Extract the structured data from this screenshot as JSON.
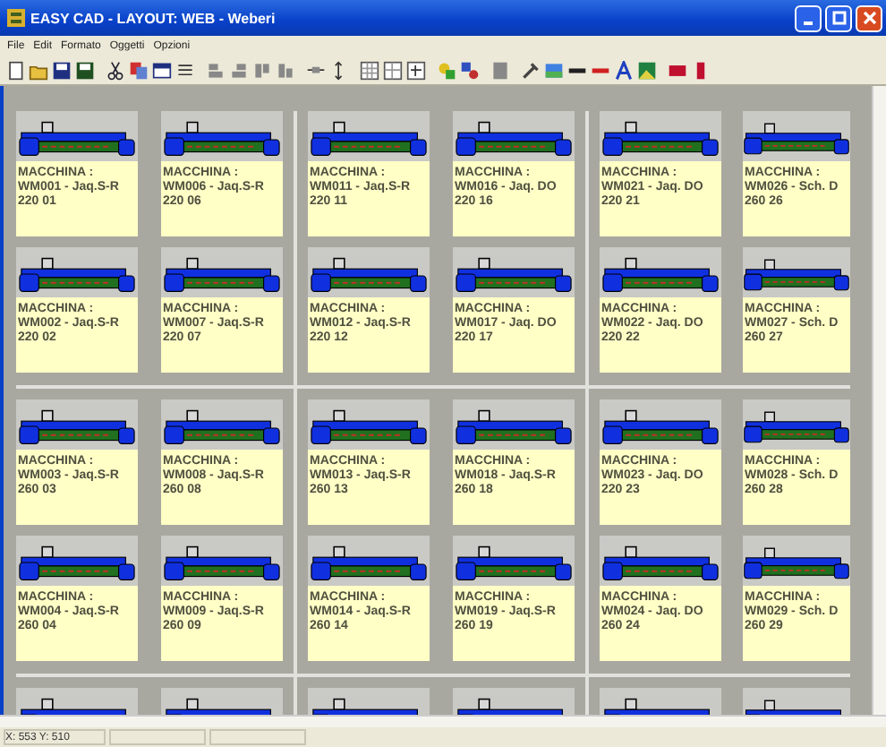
{
  "window": {
    "title": "EASY CAD - LAYOUT: WEB - Weberi"
  },
  "menu": [
    "File",
    "Edit",
    "Formato",
    "Oggetti",
    "Opzioni"
  ],
  "layout": {
    "rows": [
      {
        "cards": [
          {
            "title": "MACCHINA :",
            "code": "WM001 - Jaq.S-R",
            "position": "220 01"
          },
          {
            "title": "MACCHINA :",
            "code": "WM006 - Jaq.S-R",
            "position": "220 06"
          },
          {
            "title": "MACCHINA :",
            "code": "WM011 - Jaq.S-R",
            "position": "220 11"
          },
          {
            "title": "MACCHINA :",
            "code": "WM016 - Jaq. DO",
            "position": "220 16"
          },
          {
            "title": "MACCHINA :",
            "code": "WM021 - Jaq. DO",
            "position": "220 21"
          },
          {
            "title": "MACCHINA :",
            "code": "WM026 - Sch. D",
            "position": "260 26"
          }
        ]
      },
      {
        "cards": [
          {
            "title": "MACCHINA :",
            "code": "WM002 - Jaq.S-R",
            "position": "220 02"
          },
          {
            "title": "MACCHINA :",
            "code": "WM007 - Jaq.S-R",
            "position": "220 07"
          },
          {
            "title": "MACCHINA :",
            "code": "WM012 - Jaq.S-R",
            "position": "220 12"
          },
          {
            "title": "MACCHINA :",
            "code": "WM017 - Jaq. DO",
            "position": "220 17"
          },
          {
            "title": "MACCHINA :",
            "code": "WM022 - Jaq. DO",
            "position": "220 22"
          },
          {
            "title": "MACCHINA :",
            "code": "WM027 - Sch. D",
            "position": "260 27"
          }
        ]
      },
      {
        "cards": [
          {
            "title": "MACCHINA :",
            "code": "WM003 - Jaq.S-R",
            "position": "260 03"
          },
          {
            "title": "MACCHINA :",
            "code": "WM008 - Jaq.S-R",
            "position": "260 08"
          },
          {
            "title": "MACCHINA :",
            "code": "WM013 - Jaq.S-R",
            "position": "260 13"
          },
          {
            "title": "MACCHINA :",
            "code": "WM018 - Jaq.S-R",
            "position": "260 18"
          },
          {
            "title": "MACCHINA :",
            "code": "WM023 - Jaq. DO",
            "position": "220 23"
          },
          {
            "title": "MACCHINA :",
            "code": "WM028 - Sch. D",
            "position": "260 28"
          }
        ]
      },
      {
        "cards": [
          {
            "title": "MACCHINA :",
            "code": "WM004 - Jaq.S-R",
            "position": "260 04"
          },
          {
            "title": "MACCHINA :",
            "code": "WM009 - Jaq.S-R",
            "position": "260 09"
          },
          {
            "title": "MACCHINA :",
            "code": "WM014 - Jaq.S-R",
            "position": "260 14"
          },
          {
            "title": "MACCHINA :",
            "code": "WM019 - Jaq.S-R",
            "position": "260 19"
          },
          {
            "title": "MACCHINA :",
            "code": "WM024 - Jaq. DO",
            "position": "260 24"
          },
          {
            "title": "MACCHINA :",
            "code": "WM029 - Sch. D",
            "position": "260 29"
          }
        ]
      }
    ]
  },
  "status_bar": {
    "coordinates": "X: 553 Y: 510"
  }
}
